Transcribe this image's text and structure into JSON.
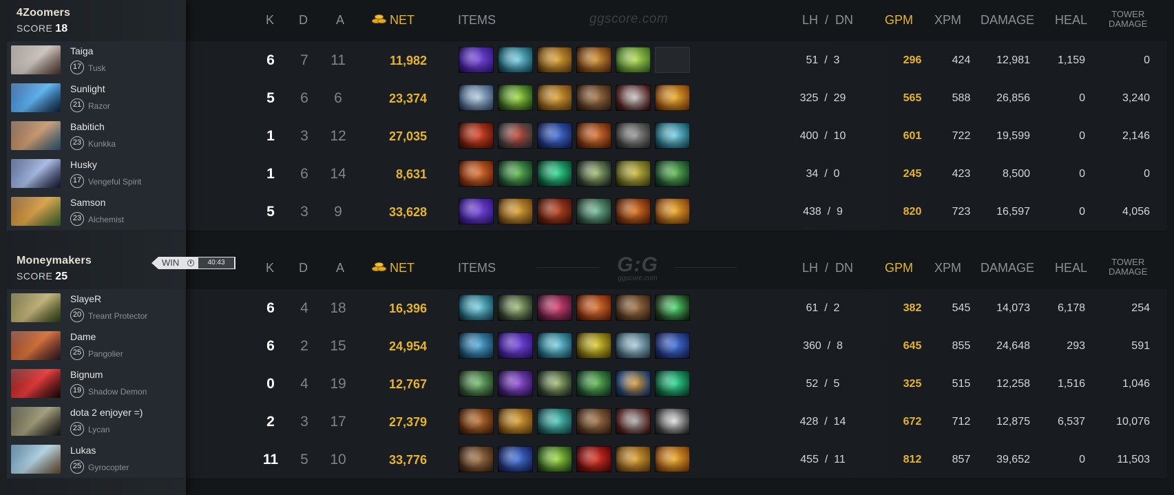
{
  "header_labels": {
    "k": "K",
    "d": "D",
    "a": "A",
    "net": "NET",
    "items": "ITEMS",
    "lh_dn": "LH  /  DN",
    "gpm": "GPM",
    "xpm": "XPM",
    "damage": "DAMAGE",
    "heal": "HEAL",
    "tower_line1": "TOWER",
    "tower_line2": "DAMAGE"
  },
  "watermark": {
    "site": "ggscore.com",
    "logo": "G:G",
    "logo_sub": "ggscore.com"
  },
  "match": {
    "result": "WIN",
    "duration": "40:43"
  },
  "colors": {
    "gold": "#e6b52c",
    "panel": "#22272c",
    "background": "#141719"
  },
  "teams": [
    {
      "name": "4Zoomers",
      "score_label": "SCORE",
      "score": "18",
      "players": [
        {
          "name": "Taiga",
          "level": "17",
          "hero": "Tusk",
          "portrait": [
            "#8f8a86",
            "#c9c2bb",
            "#5a3d36"
          ],
          "k": "6",
          "d": "7",
          "a": "11",
          "net": "11,982",
          "lh_dn": "51  /  3",
          "gpm": "296",
          "xpm": "424",
          "damage": "12,981",
          "heal": "1,159",
          "tower": "0",
          "items": [
            [
              "#3a1c8c",
              "#7c4de0"
            ],
            [
              "#1b5c6e",
              "#7fd4e8"
            ],
            [
              "#7a4f16",
              "#e0a83a"
            ],
            [
              "#6a3a12",
              "#d99a3a"
            ],
            [
              "#4a7a2a",
              "#b9e05a"
            ],
            null
          ]
        },
        {
          "name": "Sunlight",
          "level": "21",
          "hero": "Razor",
          "portrait": [
            "#1d4f8f",
            "#5fb1ee",
            "#0f2a4a"
          ],
          "k": "5",
          "d": "6",
          "a": "6",
          "net": "23,374",
          "lh_dn": "325  /  29",
          "gpm": "565",
          "xpm": "588",
          "damage": "26,856",
          "heal": "0",
          "tower": "3,240",
          "items": [
            [
              "#3f5a7a",
              "#b8cde0"
            ],
            [
              "#2e5a1a",
              "#a6e04a"
            ],
            [
              "#7a4f16",
              "#e0a83a"
            ],
            [
              "#4a2e1a",
              "#a67a4e"
            ],
            [
              "#4a1a1a",
              "#c8c8c8"
            ],
            [
              "#8a4a10",
              "#f0b030"
            ]
          ]
        },
        {
          "name": "Babitich",
          "level": "23",
          "hero": "Kunkka",
          "portrait": [
            "#6a4a36",
            "#c89a72",
            "#3a6a8a"
          ],
          "k": "1",
          "d": "3",
          "a": "12",
          "net": "27,035",
          "lh_dn": "400  /  10",
          "gpm": "601",
          "xpm": "722",
          "damage": "19,599",
          "heal": "0",
          "tower": "2,146",
          "items": [
            [
              "#6a1a0a",
              "#e04a2a"
            ],
            [
              "#3a3a3a",
              "#c84a3a"
            ],
            [
              "#1a2a6a",
              "#4a7ae0"
            ],
            [
              "#6a2a0a",
              "#e07a3a"
            ],
            [
              "#3a3a3a",
              "#9a9a9a"
            ],
            [
              "#1b5c6e",
              "#7fd4e8"
            ]
          ]
        },
        {
          "name": "Husky",
          "level": "17",
          "hero": "Vengeful Spirit",
          "portrait": [
            "#3a4a7a",
            "#a6b8e0",
            "#1a1a3a"
          ],
          "k": "1",
          "d": "6",
          "a": "14",
          "net": "8,631",
          "lh_dn": "34  /  0",
          "gpm": "245",
          "xpm": "423",
          "damage": "8,500",
          "heal": "0",
          "tower": "0",
          "items": [
            [
              "#7a2a0a",
              "#e07a3a"
            ],
            [
              "#1a4a2a",
              "#6ac05a"
            ],
            [
              "#0a5a3a",
              "#3ae09a"
            ],
            [
              "#2a3a2a",
              "#a6c07a"
            ],
            [
              "#5a5a1a",
              "#d0c04a"
            ],
            [
              "#1a4a2a",
              "#6ac05a"
            ]
          ]
        },
        {
          "name": "Samson",
          "level": "23",
          "hero": "Alchemist",
          "portrait": [
            "#7a4a1a",
            "#d6a04a",
            "#4a7a3a"
          ],
          "k": "5",
          "d": "3",
          "a": "9",
          "net": "33,628",
          "lh_dn": "438  /  9",
          "gpm": "820",
          "xpm": "723",
          "damage": "16,597",
          "heal": "0",
          "tower": "4,056",
          "items": [
            [
              "#3a1c8c",
              "#7c4de0"
            ],
            [
              "#7a4f16",
              "#e0a83a"
            ],
            [
              "#5a1a0a",
              "#c04a2a"
            ],
            [
              "#2a4a3a",
              "#7ac0a0"
            ],
            [
              "#6a2a0a",
              "#e07a2a"
            ],
            [
              "#8a4a10",
              "#f0b030"
            ]
          ]
        }
      ]
    },
    {
      "name": "Moneymakers",
      "score_label": "SCORE",
      "score": "25",
      "players": [
        {
          "name": "SlayeR",
          "level": "20",
          "hero": "Treant Protector",
          "portrait": [
            "#5a5a2a",
            "#c0b07a",
            "#3a4a1a"
          ],
          "k": "6",
          "d": "4",
          "a": "18",
          "net": "16,396",
          "lh_dn": "61  /  2",
          "gpm": "382",
          "xpm": "545",
          "damage": "14,073",
          "heal": "6,178",
          "tower": "254",
          "items": [
            [
              "#1b5c6e",
              "#7fd4e8"
            ],
            [
              "#2a3a2a",
              "#a6c07a"
            ],
            [
              "#5a1a3a",
              "#e04a7a"
            ],
            [
              "#7a2a0a",
              "#e07a3a"
            ],
            [
              "#4a2e1a",
              "#a67a4e"
            ],
            [
              "#1a3a1a",
              "#5ae07a"
            ]
          ]
        },
        {
          "name": "Dame",
          "level": "25",
          "hero": "Pangolier",
          "portrait": [
            "#6a2a1a",
            "#d0703a",
            "#3a1a2a"
          ],
          "k": "6",
          "d": "2",
          "a": "15",
          "net": "24,954",
          "lh_dn": "360  /  8",
          "gpm": "645",
          "xpm": "855",
          "damage": "24,648",
          "heal": "293",
          "tower": "591",
          "items": [
            [
              "#1a4a6a",
              "#5ab0e0"
            ],
            [
              "#3a1c8c",
              "#7c4de0"
            ],
            [
              "#1b5c6e",
              "#7fd4e8"
            ],
            [
              "#6a5a0a",
              "#e0d03a"
            ],
            [
              "#3a5a6a",
              "#b0d0e0"
            ],
            [
              "#1a2a6a",
              "#4a7ae0"
            ]
          ]
        },
        {
          "name": "Bignum",
          "level": "19",
          "hero": "Shadow Demon",
          "portrait": [
            "#5a0a0a",
            "#e03a3a",
            "#1a0a0a"
          ],
          "k": "0",
          "d": "4",
          "a": "19",
          "net": "12,767",
          "lh_dn": "52  /  5",
          "gpm": "325",
          "xpm": "515",
          "damage": "12,258",
          "heal": "1,516",
          "tower": "1,046",
          "items": [
            [
              "#2a4a2a",
              "#7ac07a"
            ],
            [
              "#3a1a6a",
              "#9a5ae0"
            ],
            [
              "#2a3a2a",
              "#a6c07a"
            ],
            [
              "#1a4a2a",
              "#6ac05a"
            ],
            [
              "#1a3a6a",
              "#e0a03a"
            ],
            [
              "#0a5a3a",
              "#3ae09a"
            ]
          ]
        },
        {
          "name": "dota 2 enjoyer =)",
          "level": "23",
          "hero": "Lycan",
          "portrait": [
            "#3a3a2a",
            "#a09a7a",
            "#1a1a1a"
          ],
          "k": "2",
          "d": "3",
          "a": "17",
          "net": "27,379",
          "lh_dn": "428  /  14",
          "gpm": "672",
          "xpm": "712",
          "damage": "12,875",
          "heal": "6,537",
          "tower": "10,076",
          "items": [
            [
              "#5a2a0a",
              "#c07a3a"
            ],
            [
              "#7a4f16",
              "#e0a83a"
            ],
            [
              "#1a5a5a",
              "#5ad0c0"
            ],
            [
              "#4a2e1a",
              "#a67a4e"
            ],
            [
              "#4a1a1a",
              "#b0b0b0"
            ],
            [
              "#3a3a3a",
              "#e0e0e0"
            ]
          ]
        },
        {
          "name": "Lukas",
          "level": "25",
          "hero": "Gyrocopter",
          "portrait": [
            "#3a6a8a",
            "#b0d0e0",
            "#7a5a3a"
          ],
          "k": "11",
          "d": "5",
          "a": "10",
          "net": "33,776",
          "lh_dn": "455  /  11",
          "gpm": "812",
          "xpm": "857",
          "damage": "39,652",
          "heal": "0",
          "tower": "11,503",
          "items": [
            [
              "#4a2e1a",
              "#a67a4e"
            ],
            [
              "#1a2a6a",
              "#4a7ae0"
            ],
            [
              "#2e5a1a",
              "#a6e04a"
            ],
            [
              "#6a0a0a",
              "#e03a2a"
            ],
            [
              "#7a4f16",
              "#e0a83a"
            ],
            [
              "#8a4a10",
              "#f0b030"
            ]
          ]
        }
      ]
    }
  ]
}
